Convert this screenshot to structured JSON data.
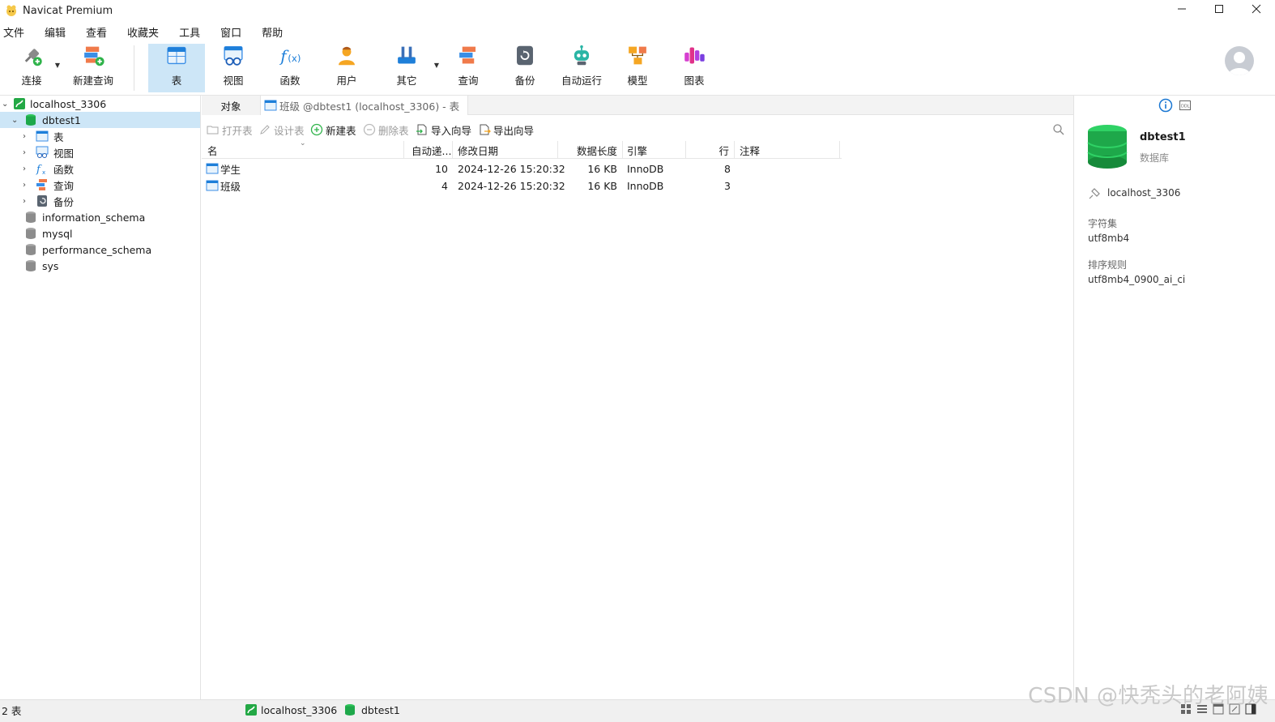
{
  "window": {
    "title": "Navicat Premium"
  },
  "menu": [
    "文件",
    "编辑",
    "查看",
    "收藏夹",
    "工具",
    "窗口",
    "帮助"
  ],
  "toolbar": {
    "connect": "连接",
    "new_query": "新建查询",
    "table": "表",
    "view": "视图",
    "function": "函数",
    "user": "用户",
    "other": "其它",
    "query": "查询",
    "backup": "备份",
    "automation": "自动运行",
    "model": "模型",
    "chart": "图表"
  },
  "tree": {
    "connection": "localhost_3306",
    "database": "dbtest1",
    "children": [
      "表",
      "视图",
      "函数",
      "查询",
      "备份"
    ],
    "other_dbs": [
      "information_schema",
      "mysql",
      "performance_schema",
      "sys"
    ]
  },
  "tabs": {
    "objects": "对象",
    "current": "班级 @dbtest1 (localhost_3306) - 表"
  },
  "object_toolbar": {
    "open": "打开表",
    "design": "设计表",
    "new": "新建表",
    "delete": "删除表",
    "import": "导入向导",
    "export": "导出向导"
  },
  "grid": {
    "headers": {
      "name": "名",
      "auto_inc": "自动递...",
      "modified": "修改日期",
      "data_len": "数据长度",
      "engine": "引擎",
      "rows": "行",
      "comment": "注释"
    },
    "rows": [
      {
        "name": "学生",
        "auto_inc": "10",
        "modified": "2024-12-26 15:20:32",
        "data_len": "16 KB",
        "engine": "InnoDB",
        "rows": "8",
        "comment": ""
      },
      {
        "name": "班级",
        "auto_inc": "4",
        "modified": "2024-12-26 15:20:32",
        "data_len": "16 KB",
        "engine": "InnoDB",
        "rows": "3",
        "comment": ""
      }
    ]
  },
  "info_panel": {
    "db_name": "dbtest1",
    "db_type": "数据库",
    "connection": "localhost_3306",
    "charset_label": "字符集",
    "charset": "utf8mb4",
    "collation_label": "排序规则",
    "collation": "utf8mb4_0900_ai_ci"
  },
  "status": {
    "count": "2 表",
    "connection": "localhost_3306",
    "database": "dbtest1"
  },
  "watermark": "CSDN @快秃头的老阿姨",
  "colors": {
    "accent": "#cde6f7",
    "db_green": "#1db954",
    "info_blue": "#1976d2"
  }
}
